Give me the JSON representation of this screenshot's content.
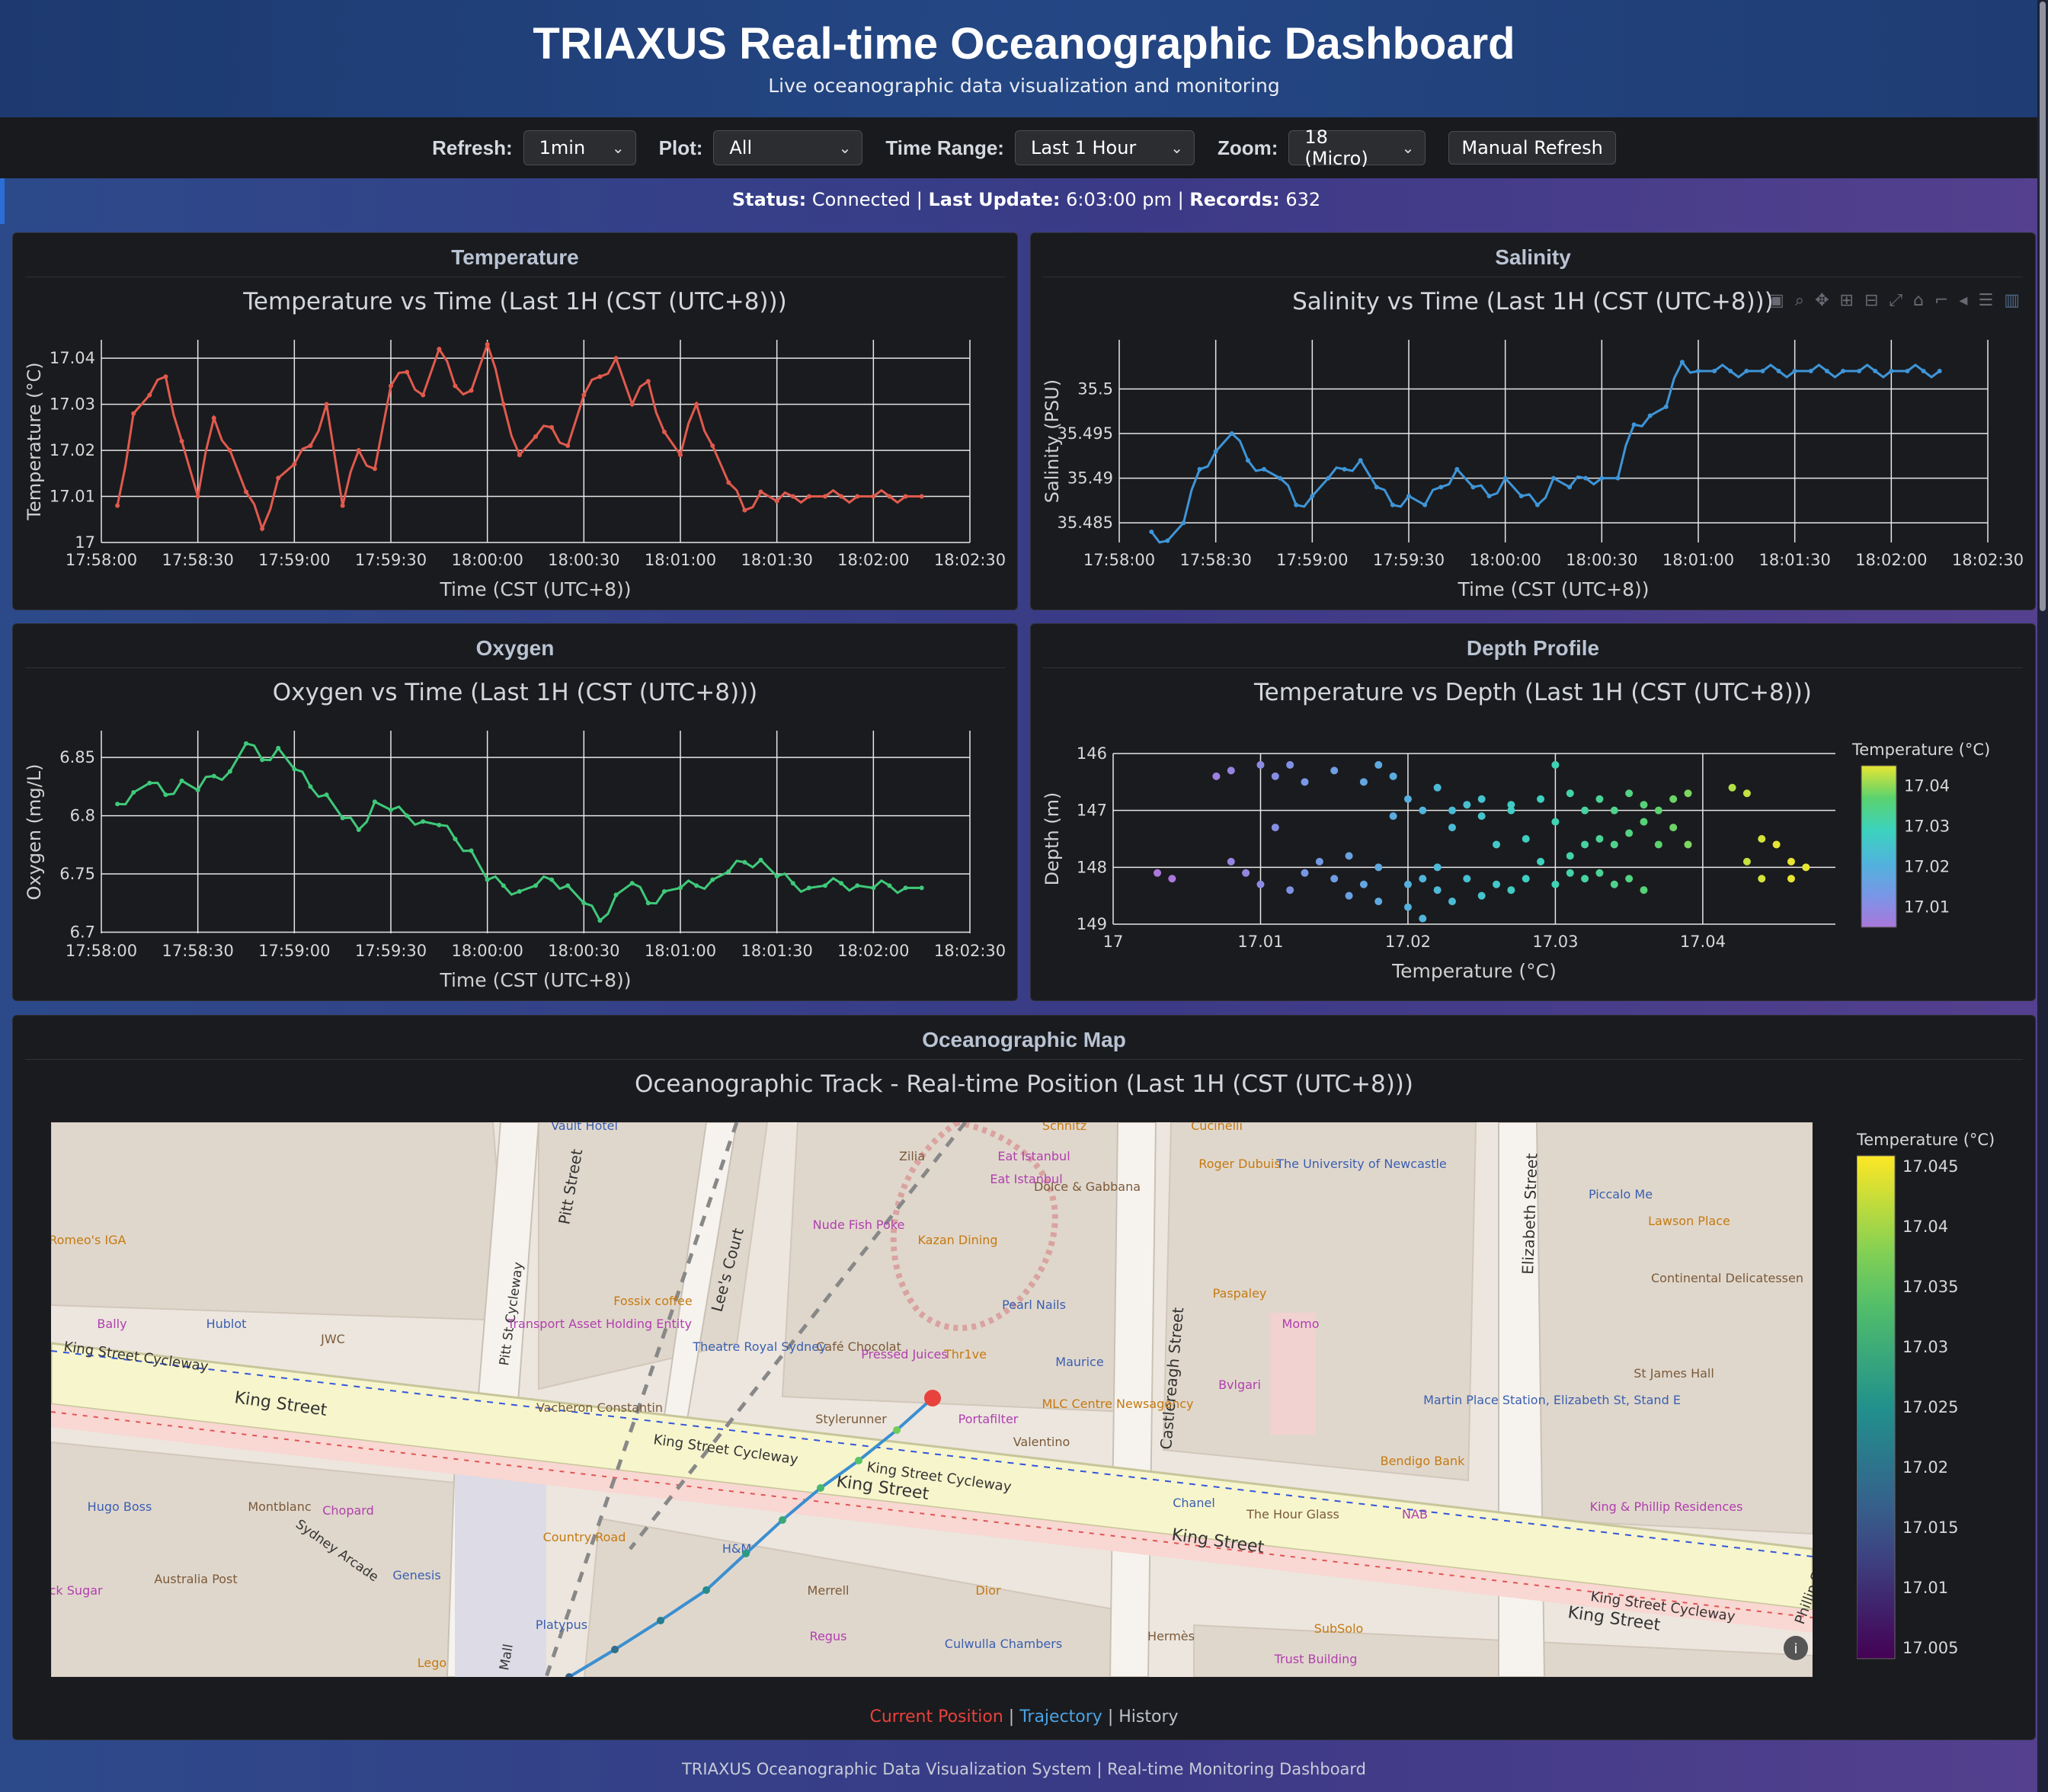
{
  "header": {
    "title": "TRIAXUS Real-time Oceanographic Dashboard",
    "subtitle": "Live oceanographic data visualization and monitoring"
  },
  "controls": {
    "refresh_label": "Refresh:",
    "refresh_value": "1min",
    "plot_label": "Plot:",
    "plot_value": "All",
    "time_range_label": "Time Range:",
    "time_range_value": "Last 1 Hour",
    "zoom_label": "Zoom:",
    "zoom_value": "18 (Micro)",
    "manual_refresh": "Manual Refresh"
  },
  "status": {
    "status_label": "Status:",
    "status_value": "Connected",
    "update_label": "Last Update:",
    "update_value": "6:03:00 pm",
    "records_label": "Records:",
    "records_value": "632",
    "sep": "|"
  },
  "panels": {
    "temperature": "Temperature",
    "salinity": "Salinity",
    "oxygen": "Oxygen",
    "depth": "Depth Profile",
    "map": "Oceanographic Map"
  },
  "colors": {
    "temperature": "#e05a4e",
    "salinity": "#3e95d8",
    "oxygen": "#3fc97a",
    "position": "#e8423c",
    "trajectory": "#3a8fd0"
  },
  "chart_data": [
    {
      "id": "temperature",
      "type": "line",
      "title": "Temperature vs Time (Last 1H (CST (UTC+8)))",
      "xlabel": "Time (CST (UTC+8))",
      "ylabel": "Temperature (°C)",
      "x_ticks": [
        "17:58:00",
        "17:58:30",
        "17:59:00",
        "17:59:30",
        "18:00:00",
        "18:00:30",
        "18:01:00",
        "18:01:30",
        "18:02:00",
        "18:02:30"
      ],
      "y_ticks": [
        "17",
        "17.01",
        "17.02",
        "17.03",
        "17.04"
      ],
      "xlim": [
        0,
        270
      ],
      "ylim": [
        17.0,
        17.044
      ],
      "series": [
        {
          "x": [
            5,
            10,
            15,
            20,
            25,
            30,
            35,
            40,
            45,
            50,
            55,
            60,
            65,
            70,
            75,
            80,
            85,
            90,
            95,
            100,
            105,
            110,
            115,
            120,
            125,
            130,
            135,
            140,
            145,
            150,
            155,
            160,
            165,
            170,
            175,
            180,
            185,
            190,
            195,
            200,
            205,
            210,
            215,
            220,
            225,
            230,
            235,
            240,
            245,
            250,
            255
          ],
          "values": [
            17.008,
            17.028,
            17.032,
            17.036,
            17.022,
            17.01,
            17.027,
            17.02,
            17.011,
            17.003,
            17.014,
            17.017,
            17.021,
            17.03,
            17.008,
            17.02,
            17.016,
            17.034,
            17.037,
            17.032,
            17.042,
            17.034,
            17.033,
            17.043,
            17.03,
            17.019,
            17.023,
            17.025,
            17.021,
            17.032,
            17.036,
            17.04,
            17.03,
            17.035,
            17.024,
            17.019,
            17.03,
            17.021,
            17.013,
            17.007,
            17.011,
            17.009,
            17.01,
            17.01,
            17.01,
            17.01,
            17.01,
            17.01,
            17.01,
            17.01,
            17.01
          ]
        }
      ]
    },
    {
      "id": "salinity",
      "type": "line",
      "title": "Salinity vs Time (Last 1H (CST (UTC+8)))",
      "xlabel": "Time (CST (UTC+8))",
      "ylabel": "Salinity (PSU)",
      "x_ticks": [
        "17:58:00",
        "17:58:30",
        "17:59:00",
        "17:59:30",
        "18:00:00",
        "18:00:30",
        "18:01:00",
        "18:01:30",
        "18:02:00",
        "18:02:30"
      ],
      "y_ticks": [
        "35.485",
        "35.49",
        "35.495",
        "35.5"
      ],
      "xlim": [
        0,
        270
      ],
      "ylim": [
        35.4828,
        35.5055
      ],
      "series": [
        {
          "x": [
            10,
            15,
            20,
            25,
            30,
            35,
            40,
            45,
            50,
            55,
            60,
            65,
            70,
            75,
            80,
            85,
            90,
            95,
            100,
            105,
            110,
            115,
            120,
            125,
            130,
            135,
            140,
            145,
            150,
            155,
            160,
            165,
            170,
            175,
            180,
            185,
            190,
            195,
            200,
            205,
            210,
            215,
            220,
            225,
            230,
            235,
            240,
            245,
            250,
            255
          ],
          "values": [
            35.484,
            35.483,
            35.485,
            35.491,
            35.493,
            35.495,
            35.492,
            35.491,
            35.49,
            35.487,
            35.488,
            35.49,
            35.491,
            35.492,
            35.489,
            35.487,
            35.488,
            35.487,
            35.489,
            35.491,
            35.489,
            35.488,
            35.49,
            35.488,
            35.487,
            35.49,
            35.489,
            35.49,
            35.49,
            35.49,
            35.496,
            35.497,
            35.498,
            35.503,
            35.502,
            35.502,
            35.502,
            35.502,
            35.502,
            35.502,
            35.502,
            35.502,
            35.502,
            35.502,
            35.502,
            35.502,
            35.502,
            35.502,
            35.502,
            35.502
          ]
        }
      ]
    },
    {
      "id": "oxygen",
      "type": "line",
      "title": "Oxygen vs Time (Last 1H (CST (UTC+8)))",
      "xlabel": "Time (CST (UTC+8))",
      "ylabel": "Oxygen (mg/L)",
      "x_ticks": [
        "17:58:00",
        "17:58:30",
        "17:59:00",
        "17:59:30",
        "18:00:00",
        "18:00:30",
        "18:01:00",
        "18:01:30",
        "18:02:00",
        "18:02:30"
      ],
      "y_ticks": [
        "6.7",
        "6.75",
        "6.8",
        "6.85"
      ],
      "xlim": [
        0,
        270
      ],
      "ylim": [
        6.699,
        6.873
      ],
      "series": [
        {
          "x": [
            5,
            10,
            15,
            20,
            25,
            30,
            35,
            40,
            45,
            50,
            55,
            60,
            65,
            70,
            75,
            80,
            85,
            90,
            95,
            100,
            105,
            110,
            115,
            120,
            125,
            130,
            135,
            140,
            145,
            150,
            155,
            160,
            165,
            170,
            175,
            180,
            185,
            190,
            195,
            200,
            205,
            210,
            215,
            220,
            225,
            230,
            235,
            240,
            245,
            250,
            255
          ],
          "values": [
            6.81,
            6.82,
            6.828,
            6.818,
            6.83,
            6.822,
            6.834,
            6.838,
            6.862,
            6.848,
            6.858,
            6.84,
            6.825,
            6.818,
            6.798,
            6.788,
            6.812,
            6.805,
            6.8,
            6.795,
            6.792,
            6.78,
            6.77,
            6.745,
            6.74,
            6.735,
            6.74,
            6.745,
            6.74,
            6.725,
            6.71,
            6.732,
            6.742,
            6.725,
            6.735,
            6.738,
            6.74,
            6.745,
            6.752,
            6.76,
            6.762,
            6.748,
            6.742,
            6.738,
            6.74,
            6.742,
            6.74,
            6.738,
            6.74,
            6.738,
            6.738
          ]
        }
      ]
    },
    {
      "id": "depth",
      "type": "scatter",
      "title": "Temperature vs Depth (Last 1H (CST (UTC+8)))",
      "xlabel": "Temperature (°C)",
      "ylabel": "Depth (m)",
      "x_ticks": [
        "17",
        "17.01",
        "17.02",
        "17.03",
        "17.04"
      ],
      "y_ticks": [
        "146",
        "147",
        "148",
        "149"
      ],
      "xlim": [
        17.0,
        17.049
      ],
      "ylim": [
        146,
        149
      ],
      "y_reversed": true,
      "colorbar": {
        "title": "Temperature (°C)",
        "ticks": [
          "17.01",
          "17.02",
          "17.03",
          "17.04"
        ],
        "min": 17.005,
        "max": 17.045
      },
      "points": [
        [
          17.003,
          148.1
        ],
        [
          17.004,
          148.2
        ],
        [
          17.007,
          146.4
        ],
        [
          17.008,
          146.3
        ],
        [
          17.008,
          147.9
        ],
        [
          17.009,
          148.1
        ],
        [
          17.01,
          146.2
        ],
        [
          17.01,
          148.3
        ],
        [
          17.011,
          147.3
        ],
        [
          17.011,
          146.4
        ],
        [
          17.012,
          148.4
        ],
        [
          17.012,
          146.2
        ],
        [
          17.013,
          148.1
        ],
        [
          17.013,
          146.5
        ],
        [
          17.014,
          147.9
        ],
        [
          17.015,
          148.2
        ],
        [
          17.015,
          146.3
        ],
        [
          17.016,
          148.5
        ],
        [
          17.016,
          147.8
        ],
        [
          17.017,
          146.5
        ],
        [
          17.017,
          148.3
        ],
        [
          17.018,
          146.2
        ],
        [
          17.018,
          148.6
        ],
        [
          17.018,
          148.0
        ],
        [
          17.019,
          146.4
        ],
        [
          17.019,
          147.1
        ],
        [
          17.02,
          148.3
        ],
        [
          17.02,
          148.7
        ],
        [
          17.02,
          146.8
        ],
        [
          17.021,
          148.2
        ],
        [
          17.021,
          148.9
        ],
        [
          17.021,
          147.0
        ],
        [
          17.022,
          148.4
        ],
        [
          17.022,
          148.0
        ],
        [
          17.022,
          146.6
        ],
        [
          17.023,
          148.6
        ],
        [
          17.023,
          147.3
        ],
        [
          17.023,
          147.0
        ],
        [
          17.024,
          148.2
        ],
        [
          17.024,
          146.9
        ],
        [
          17.025,
          148.5
        ],
        [
          17.025,
          147.1
        ],
        [
          17.025,
          146.8
        ],
        [
          17.026,
          148.3
        ],
        [
          17.026,
          147.6
        ],
        [
          17.027,
          147.0
        ],
        [
          17.027,
          148.4
        ],
        [
          17.027,
          146.9
        ],
        [
          17.028,
          147.5
        ],
        [
          17.028,
          148.2
        ],
        [
          17.029,
          146.8
        ],
        [
          17.029,
          147.9
        ],
        [
          17.03,
          148.3
        ],
        [
          17.03,
          146.2
        ],
        [
          17.03,
          147.2
        ],
        [
          17.031,
          147.8
        ],
        [
          17.031,
          146.7
        ],
        [
          17.031,
          148.1
        ],
        [
          17.032,
          147.6
        ],
        [
          17.032,
          147.0
        ],
        [
          17.032,
          148.2
        ],
        [
          17.033,
          146.8
        ],
        [
          17.033,
          147.5
        ],
        [
          17.033,
          148.1
        ],
        [
          17.034,
          147.0
        ],
        [
          17.034,
          147.6
        ],
        [
          17.034,
          148.3
        ],
        [
          17.035,
          146.7
        ],
        [
          17.035,
          147.4
        ],
        [
          17.035,
          148.2
        ],
        [
          17.036,
          147.2
        ],
        [
          17.036,
          146.9
        ],
        [
          17.036,
          148.4
        ],
        [
          17.037,
          147.6
        ],
        [
          17.037,
          147.0
        ],
        [
          17.038,
          146.8
        ],
        [
          17.038,
          147.3
        ],
        [
          17.039,
          146.7
        ],
        [
          17.039,
          147.6
        ],
        [
          17.042,
          146.6
        ],
        [
          17.043,
          146.7
        ],
        [
          17.043,
          147.9
        ],
        [
          17.044,
          147.5
        ],
        [
          17.044,
          148.2
        ],
        [
          17.045,
          147.6
        ],
        [
          17.046,
          148.2
        ],
        [
          17.046,
          147.9
        ],
        [
          17.047,
          148.0
        ]
      ]
    }
  ],
  "map": {
    "title": "Oceanographic Track - Real-time Position (Last 1H (CST (UTC+8)))",
    "colorbar": {
      "title": "Temperature (°C)",
      "ticks": [
        "17.045",
        "17.04",
        "17.035",
        "17.03",
        "17.025",
        "17.02",
        "17.015",
        "17.01",
        "17.005"
      ]
    },
    "streets": {
      "king_street": "King Street",
      "king_cycleway": "King Street Cycleway",
      "pitt_street": "Pitt Street",
      "elizabeth_street": "Elizabeth Street",
      "castlereagh_street": "Castlereagh Street",
      "lees_court": "Lee's Court",
      "phillip_street": "Phillip Street",
      "sydney_arcade": "Sydney Arcade",
      "pitt_st_cycleway": "Pitt St Cycleway",
      "mall": "Mall"
    },
    "places": [
      "Nude Fish Poke",
      "Kazan Dining",
      "Pearl Nails",
      "Café Chocolat",
      "Pressed Juices",
      "Thr1ve",
      "Theatre Royal Sydney",
      "Stylerunner",
      "Portafilter",
      "MLC Centre Newsagency",
      "Maurice",
      "Valentino",
      "Bvlgari",
      "Paspaley",
      "Chanel",
      "The Hour Glass",
      "NAB",
      "Bendigo Bank",
      "Martin Place Station, Elizabeth St, Stand E",
      "St James Hall",
      "King & Phillip Residences",
      "Lawson Place",
      "Piccalo Me",
      "Continental Delicatessen",
      "Momo",
      "Roger Dubuis",
      "The University of Newcastle",
      "Dolce & Gabbana",
      "Eat Istanbul",
      "Schnitz",
      "Hugo Boss",
      "Montblanc",
      "Chopard",
      "Country Road",
      "H&M",
      "Merrell",
      "Regus",
      "Dior",
      "Culwulla Chambers",
      "Hermès",
      "Trust Building",
      "SubSolo",
      "Genesis",
      "Australia Post",
      "Black Sugar",
      "Lego",
      "Platypus",
      "Vacheron Constantin",
      "Transport Asset Holding Entity",
      "Fossix coffee",
      "Hublot",
      "JWC",
      "Bally",
      "Locali by Romeo's IGA",
      "Vault Hotel",
      "Zilia",
      "Eat Istanbul",
      "Cucinelli"
    ],
    "legend": {
      "current": "Current Position",
      "trajectory": "Trajectory",
      "history": "History",
      "sep": "|"
    }
  },
  "footer": "TRIAXUS Oceanographic Data Visualization System | Real-time Monitoring Dashboard"
}
